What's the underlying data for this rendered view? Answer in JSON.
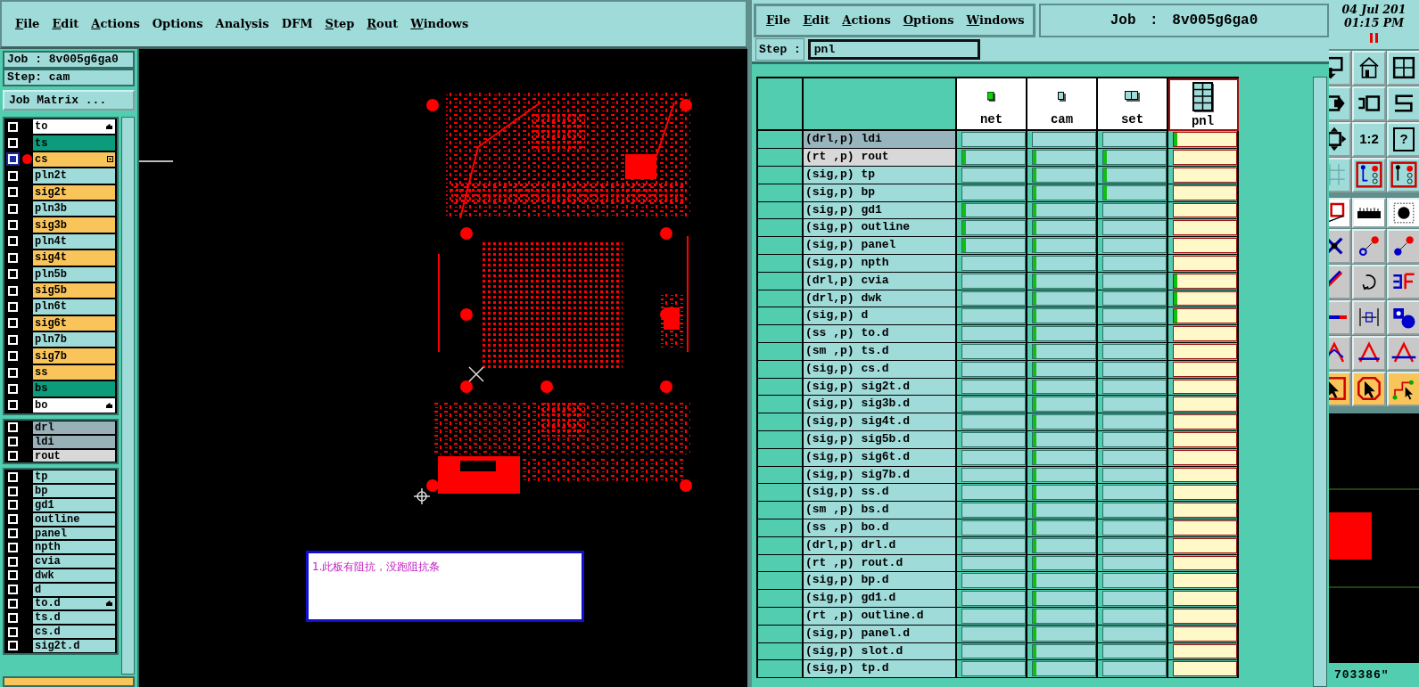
{
  "main_window": {
    "menu": [
      {
        "label": "File",
        "mnemonic": true
      },
      {
        "label": "Edit",
        "mnemonic": true
      },
      {
        "label": "Actions",
        "mnemonic": true
      },
      {
        "label": "Options",
        "mnemonic": false
      },
      {
        "label": "Analysis",
        "mnemonic": false
      },
      {
        "label": "DFM",
        "mnemonic": false
      },
      {
        "label": "Step",
        "mnemonic": true
      },
      {
        "label": "Rout",
        "mnemonic": true
      },
      {
        "label": "Windows",
        "mnemonic": true
      }
    ]
  },
  "job_panel": {
    "job": "Job : 8v005g6ga0",
    "step": "Step: cam",
    "matrix_button": "Job Matrix ..."
  },
  "layer_groups": [
    {
      "layers": [
        {
          "name": "to",
          "color": "#ffffff",
          "selected": false,
          "pointer": true
        },
        {
          "name": "ts",
          "color": "#0c9c7c",
          "selected": false
        },
        {
          "name": "cs",
          "color": "#f9c45a",
          "selected": true,
          "boxed": true
        },
        {
          "name": "pln2t",
          "color": "#9fdbd9",
          "selected": false
        },
        {
          "name": "sig2t",
          "color": "#f9c45a",
          "selected": false
        },
        {
          "name": "pln3b",
          "color": "#9fdbd9",
          "selected": false
        },
        {
          "name": "sig3b",
          "color": "#f9c45a",
          "selected": false
        },
        {
          "name": "pln4t",
          "color": "#9fdbd9",
          "selected": false
        },
        {
          "name": "sig4t",
          "color": "#f9c45a",
          "selected": false
        },
        {
          "name": "pln5b",
          "color": "#9fdbd9",
          "selected": false
        },
        {
          "name": "sig5b",
          "color": "#f9c45a",
          "selected": false
        },
        {
          "name": "pln6t",
          "color": "#9fdbd9",
          "selected": false
        },
        {
          "name": "sig6t",
          "color": "#f9c45a",
          "selected": false
        },
        {
          "name": "pln7b",
          "color": "#9fdbd9",
          "selected": false
        },
        {
          "name": "sig7b",
          "color": "#f9c45a",
          "selected": false
        },
        {
          "name": "ss",
          "color": "#f9c45a",
          "selected": false
        },
        {
          "name": "bs",
          "color": "#0c9c7c",
          "selected": false
        },
        {
          "name": "bo",
          "color": "#ffffff",
          "selected": false,
          "pointer": true
        }
      ]
    },
    {
      "layers": [
        {
          "name": "drl",
          "color": "#98b0b8",
          "selected": false
        },
        {
          "name": "ldi",
          "color": "#98b0b8",
          "selected": false
        },
        {
          "name": "rout",
          "color": "#d8d8d8",
          "selected": false
        }
      ]
    },
    {
      "layers": [
        {
          "name": "tp",
          "color": "#9fdbd9",
          "selected": false
        },
        {
          "name": "bp",
          "color": "#9fdbd9",
          "selected": false
        },
        {
          "name": "gd1",
          "color": "#9fdbd9",
          "selected": false
        },
        {
          "name": "outline",
          "color": "#9fdbd9",
          "selected": false
        },
        {
          "name": "panel",
          "color": "#9fdbd9",
          "selected": false
        },
        {
          "name": "npth",
          "color": "#9fdbd9",
          "selected": false
        },
        {
          "name": "cvia",
          "color": "#9fdbd9",
          "selected": false
        },
        {
          "name": "dwk",
          "color": "#9fdbd9",
          "selected": false
        },
        {
          "name": "d",
          "color": "#9fdbd9",
          "selected": false
        },
        {
          "name": "to.d",
          "color": "#9fdbd9",
          "selected": false,
          "pointer": true
        },
        {
          "name": "ts.d",
          "color": "#9fdbd9",
          "selected": false
        },
        {
          "name": "cs.d",
          "color": "#9fdbd9",
          "selected": false
        },
        {
          "name": "sig2t.d",
          "color": "#9fdbd9",
          "selected": false
        }
      ]
    }
  ],
  "note": {
    "text": "1.此板有阻抗，没跑阻抗条"
  },
  "matrix_window": {
    "menu": [
      {
        "label": "File",
        "mnemonic": true
      },
      {
        "label": "Edit",
        "mnemonic": true
      },
      {
        "label": "Actions",
        "mnemonic": true
      },
      {
        "label": "Options",
        "mnemonic": true
      },
      {
        "label": "Windows",
        "mnemonic": true
      }
    ],
    "job": "Job : 8v005g6ga0",
    "step_label": "Step :",
    "step_value": "pnl"
  },
  "matrix": {
    "columns": [
      {
        "label": "net",
        "kind": "net",
        "selected": false
      },
      {
        "label": "cam",
        "kind": "single",
        "selected": false
      },
      {
        "label": "set",
        "kind": "set",
        "selected": false
      },
      {
        "label": "pnl",
        "kind": "panel",
        "selected": true
      }
    ],
    "rows": [
      {
        "label": "(drl,p) ldi",
        "color": "#98b4bc",
        "marks": [
          false,
          false,
          false,
          true
        ]
      },
      {
        "label": "(rt ,p) rout",
        "color": "#d8d8d8",
        "marks": [
          true,
          true,
          true,
          false
        ]
      },
      {
        "label": "(sig,p) tp",
        "color": "#9fdbd9",
        "marks": [
          false,
          true,
          true,
          false
        ]
      },
      {
        "label": "(sig,p) bp",
        "color": "#9fdbd9",
        "marks": [
          false,
          true,
          true,
          false
        ]
      },
      {
        "label": "(sig,p) gd1",
        "color": "#9fdbd9",
        "marks": [
          true,
          true,
          false,
          false
        ]
      },
      {
        "label": "(sig,p) outline",
        "color": "#9fdbd9",
        "marks": [
          true,
          true,
          false,
          false
        ]
      },
      {
        "label": "(sig,p) panel",
        "color": "#9fdbd9",
        "marks": [
          true,
          true,
          false,
          false
        ]
      },
      {
        "label": "(sig,p) npth",
        "color": "#9fdbd9",
        "marks": [
          false,
          true,
          false,
          false
        ]
      },
      {
        "label": "(drl,p) cvia",
        "color": "#9fdbd9",
        "marks": [
          false,
          true,
          false,
          true
        ]
      },
      {
        "label": "(drl,p) dwk",
        "color": "#9fdbd9",
        "marks": [
          false,
          true,
          false,
          true
        ]
      },
      {
        "label": "(sig,p) d",
        "color": "#9fdbd9",
        "marks": [
          false,
          true,
          false,
          true
        ]
      },
      {
        "label": "(ss ,p) to.d",
        "color": "#9fdbd9",
        "marks": [
          false,
          true,
          false,
          false
        ]
      },
      {
        "label": "(sm ,p) ts.d",
        "color": "#9fdbd9",
        "marks": [
          false,
          true,
          false,
          false
        ]
      },
      {
        "label": "(sig,p) cs.d",
        "color": "#9fdbd9",
        "marks": [
          false,
          true,
          false,
          false
        ]
      },
      {
        "label": "(sig,p) sig2t.d",
        "color": "#9fdbd9",
        "marks": [
          false,
          true,
          false,
          false
        ]
      },
      {
        "label": "(sig,p) sig3b.d",
        "color": "#9fdbd9",
        "marks": [
          false,
          true,
          false,
          false
        ]
      },
      {
        "label": "(sig,p) sig4t.d",
        "color": "#9fdbd9",
        "marks": [
          false,
          true,
          false,
          false
        ]
      },
      {
        "label": "(sig,p) sig5b.d",
        "color": "#9fdbd9",
        "marks": [
          false,
          true,
          false,
          false
        ]
      },
      {
        "label": "(sig,p) sig6t.d",
        "color": "#9fdbd9",
        "marks": [
          false,
          true,
          false,
          false
        ]
      },
      {
        "label": "(sig,p) sig7b.d",
        "color": "#9fdbd9",
        "marks": [
          false,
          true,
          false,
          false
        ]
      },
      {
        "label": "(sig,p) ss.d",
        "color": "#9fdbd9",
        "marks": [
          false,
          true,
          false,
          false
        ]
      },
      {
        "label": "(sm ,p) bs.d",
        "color": "#9fdbd9",
        "marks": [
          false,
          true,
          false,
          false
        ]
      },
      {
        "label": "(ss ,p) bo.d",
        "color": "#9fdbd9",
        "marks": [
          false,
          true,
          false,
          false
        ]
      },
      {
        "label": "(drl,p) drl.d",
        "color": "#9fdbd9",
        "marks": [
          false,
          true,
          false,
          false
        ]
      },
      {
        "label": "(rt ,p) rout.d",
        "color": "#9fdbd9",
        "marks": [
          false,
          true,
          false,
          false
        ]
      },
      {
        "label": "(sig,p) bp.d",
        "color": "#9fdbd9",
        "marks": [
          false,
          true,
          false,
          false
        ]
      },
      {
        "label": "(sig,p) gd1.d",
        "color": "#9fdbd9",
        "marks": [
          false,
          true,
          false,
          false
        ]
      },
      {
        "label": "(rt ,p) outline.d",
        "color": "#9fdbd9",
        "marks": [
          false,
          true,
          false,
          false
        ]
      },
      {
        "label": "(sig,p) panel.d",
        "color": "#9fdbd9",
        "marks": [
          false,
          true,
          false,
          false
        ]
      },
      {
        "label": "(sig,p) slot.d",
        "color": "#9fdbd9",
        "marks": [
          false,
          true,
          false,
          false
        ]
      },
      {
        "label": "(sig,p) tp.d",
        "color": "#9fdbd9",
        "marks": [
          false,
          true,
          false,
          false
        ]
      }
    ]
  },
  "clock": {
    "date": "04 Jul 201",
    "time": "01:15 PM"
  },
  "toolbar": {
    "ratio": "1:2",
    "help": "?"
  },
  "coordinate": "703386\""
}
